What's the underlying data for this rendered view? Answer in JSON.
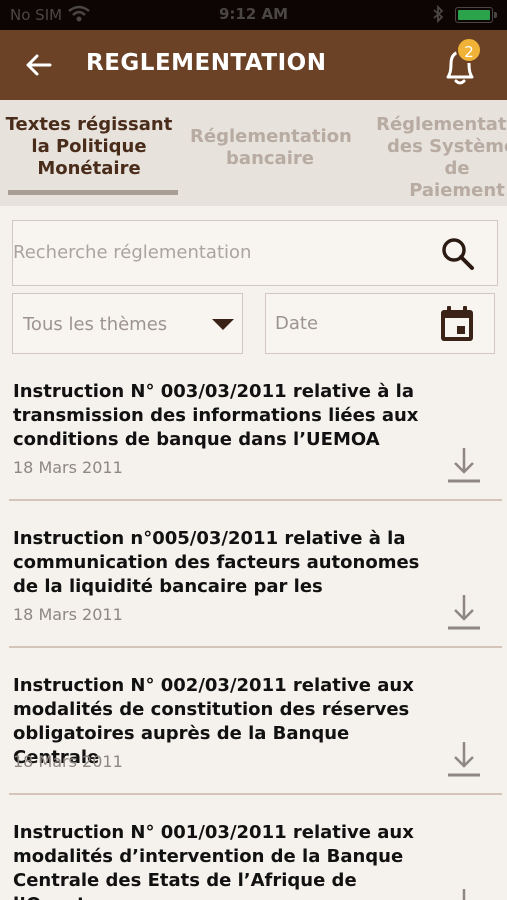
{
  "status_bar": {
    "carrier": "No SIM",
    "time": "9:12 AM"
  },
  "header": {
    "title": "REGLEMENTATION",
    "notification_count": "2",
    "icons": {
      "back": "arrow-left-icon",
      "notifications": "bell-icon"
    }
  },
  "tabs": [
    {
      "line1": "Textes régissant",
      "line2": "la Politique",
      "line3": "Monétaire",
      "active": true
    },
    {
      "line1": "Réglementation",
      "line2": "bancaire",
      "line3": "",
      "active": false
    },
    {
      "line1": "Réglementation",
      "line2": "des Systèmes de",
      "line3": "Paiement",
      "active": false
    }
  ],
  "search": {
    "placeholder": "Recherche réglementation",
    "icon": "search-icon"
  },
  "filters": {
    "theme_label": "Tous les thèmes",
    "date_label": "Date",
    "icons": {
      "theme": "chevron-down-icon",
      "date": "calendar-icon"
    }
  },
  "documents": [
    {
      "line1": "Instruction N° 003/03/2011 relative à la",
      "line2": "transmission des informations liées aux",
      "line3": "conditions de banque dans l’UEMOA",
      "date": "18 Mars 2011"
    },
    {
      "line1": "Instruction n°005/03/2011 relative à la",
      "line2": "communication des facteurs autonomes",
      "line3": "de la liquidité bancaire par les",
      "date": "18 Mars 2011"
    },
    {
      "line1": "Instruction N° 002/03/2011 relative aux",
      "line2": "modalités de constitution des réserves",
      "line3": "obligatoires auprès de la Banque Centrale",
      "date": "18 Mars 2011"
    },
    {
      "line1": "Instruction N° 001/03/2011 relative aux",
      "line2": "modalités d’intervention de la Banque",
      "line3": "Centrale des Etats de l’Afrique de l’Ouest",
      "date": ""
    }
  ],
  "colors": {
    "header_brown": "#6b4226",
    "badge": "#f0b338",
    "battery": "#2ba34a",
    "icon_dark": "#3a2216"
  }
}
